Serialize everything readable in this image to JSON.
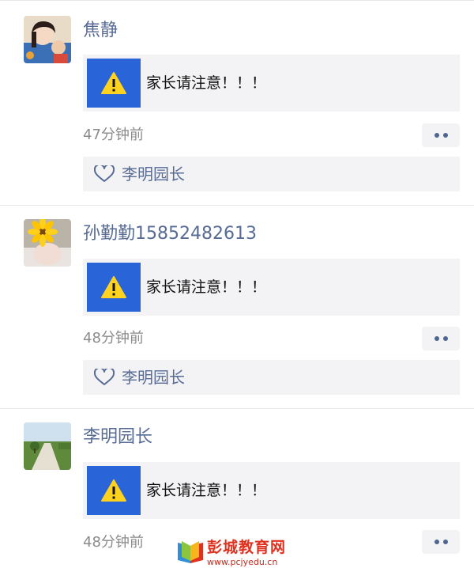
{
  "posts": [
    {
      "author": "焦静",
      "link_title": "家长请注意！！！",
      "time": "47分钟前",
      "likes": [
        "李明园长"
      ]
    },
    {
      "author": "孙勤勤15852482613",
      "link_title": "家长请注意！！！",
      "time": "48分钟前",
      "likes": [
        "李明园长"
      ]
    },
    {
      "author": "李明园长",
      "link_title": "家长请注意！！！",
      "time": "48分钟前"
    }
  ],
  "icons": {
    "link_thumb": "warning-icon",
    "more": "more-dots-icon",
    "like": "heart-icon"
  },
  "watermark": {
    "title": "彭城教育网",
    "url": "www.pcjyedu.cn"
  },
  "colors": {
    "name_link": "#576b95",
    "card_bg": "#f3f3f5",
    "thumb_bg": "#2a64d9",
    "warning_yellow": "#ffd21f",
    "time_gray": "#8b8b8b",
    "watermark_red": "#e0311f"
  }
}
